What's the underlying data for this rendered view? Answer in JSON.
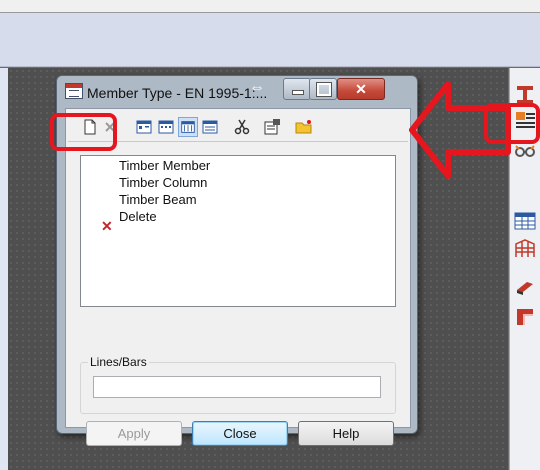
{
  "dialog": {
    "title": "Member Type - EN 1995-1:...",
    "list_items": [
      {
        "label": "Timber Member"
      },
      {
        "label": "Timber Column"
      },
      {
        "label": "Timber Beam"
      },
      {
        "label": "Delete"
      }
    ],
    "group_label": "Lines/Bars",
    "lines_bars_value": "",
    "buttons": {
      "apply": "Apply",
      "close": "Close",
      "help": "Help"
    }
  },
  "colors": {
    "annotation": "#e5161e",
    "delete_icon": "#c0272d",
    "close_button": "#c54a3a"
  }
}
